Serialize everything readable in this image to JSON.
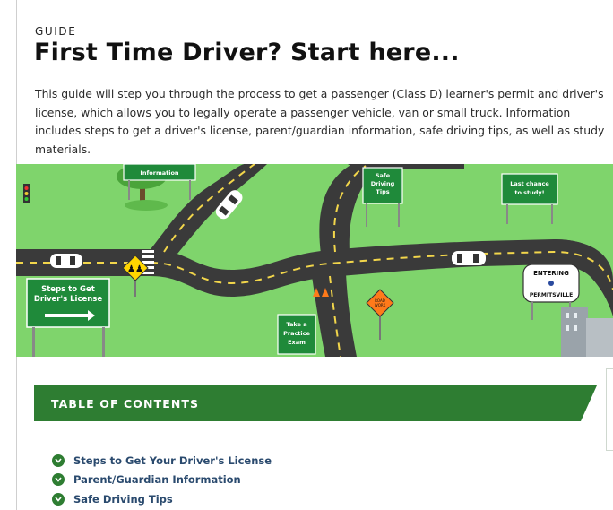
{
  "header": {
    "eyebrow": "GUIDE",
    "title": "First Time Driver? Start here...",
    "intro": "This guide will step you through the process to get a passenger (Class D) learner's permit and driver's license, which allows you to legally operate a passenger vehicle, van or small truck. Information includes steps to get a driver's license, parent/guardian information, safe driving tips, as well as study materials."
  },
  "hero": {
    "signs": {
      "information": "Information",
      "safe_driving_tips": [
        "Safe",
        "Driving",
        "Tips"
      ],
      "last_chance": [
        "Last chance",
        "to study!"
      ],
      "steps_to_get": [
        "Steps to Get",
        "Driver's License"
      ],
      "practice_exam": [
        "Take a",
        "Practice",
        "Exam"
      ],
      "road_work": [
        "ROAD",
        "WORK"
      ],
      "entering": "ENTERING",
      "permitsville": "PERMITSVILLE"
    },
    "colors": {
      "grass": "#7ed36b",
      "road": "#3a3a3a",
      "sign_green": "#1f8a3a",
      "lane": "#f2d64b"
    }
  },
  "toc": {
    "title": "TABLE OF CONTENTS",
    "color": "#2e7d32",
    "items": [
      {
        "label": "Steps to Get Your Driver's License"
      },
      {
        "label": "Parent/Guardian Information"
      },
      {
        "label": "Safe Driving Tips"
      }
    ]
  }
}
